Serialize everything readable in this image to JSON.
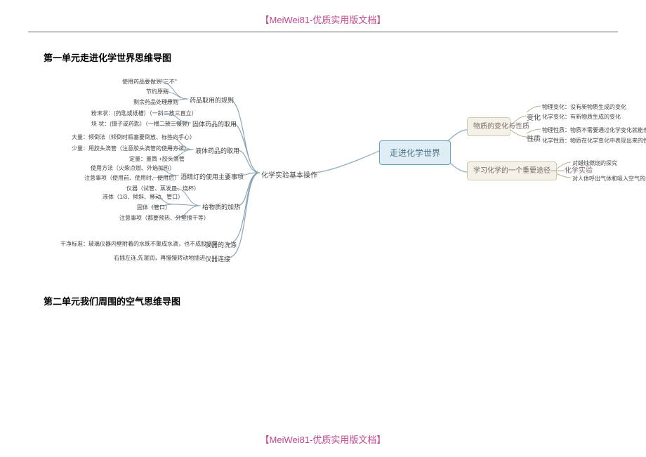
{
  "header": "【MeiWei81-优质实用版文档】",
  "footer": "【MeiWei81-优质实用版文档】",
  "section1_title": "第一单元走进化学世界思维导图",
  "section2_title": "第二单元我们周围的空气思维导图",
  "mindmap": {
    "root": "走进化学世界",
    "right": {
      "r1": {
        "title": "物质的变化与性质",
        "sub1": "变化",
        "sub2": "性质",
        "leaves1": [
          "物理变化：没有新物质生成的变化",
          "化学变化：有新物质生成的变化"
        ],
        "leaves2": [
          "物理性质：物质不需要通过化学变化就能表现出来的性质",
          "化学性质：物质在化学变化中表现出来的性质"
        ]
      },
      "r2": {
        "title": "学习化学的一个重要途径——化学实验",
        "leaves": [
          "对蜡烛燃烧的探究",
          "对人体呼出气体和吸入空气的探究"
        ]
      }
    },
    "left": {
      "main": "化学实验基本操作",
      "g1": {
        "title": "药品取用的规则",
        "items": [
          "使用药品要做到\"三不\"",
          "节约原则",
          "剩余药品处理原则"
        ]
      },
      "g2": {
        "title": "固体药品的取用",
        "items": [
          "粉末状：(药匙或纸槽）（一斜二放三直立）",
          "块 状：(镊子或药匙）（一横二放三慢竖)"
        ]
      },
      "g3": {
        "title": "液体药品的取用",
        "items": [
          "大量：倾倒法（倾倒时瓶塞要倒放、标签向手心）",
          "少量：用胶头滴管（注意胶头滴管的使用方法）",
          "定量：量筒 +胶头滴管"
        ]
      },
      "g4": {
        "title": "酒精灯的使用主要事项",
        "items": [
          "使用方法（火柴点燃、外焰加热）",
          "注意事项（使用前、使用时、使用后）"
        ]
      },
      "g5": {
        "title": "给物质的加热",
        "sub": "仪器（试管、蒸发皿、烧杯）",
        "items": [
          "液体（1/3、倾斜、移动、管口）",
          "固体（管口）",
          "注意事项（都要预热、外壁擦干等）"
        ]
      },
      "g6": {
        "title": "仪器的洗涤",
        "item": "干净标准：玻璃仪器内壁附着的水既不聚成水滴，也不成股流下"
      },
      "g7": {
        "title": "仪器连接",
        "item": "右插左连,先湿润，再慢慢转动地插进"
      }
    }
  }
}
